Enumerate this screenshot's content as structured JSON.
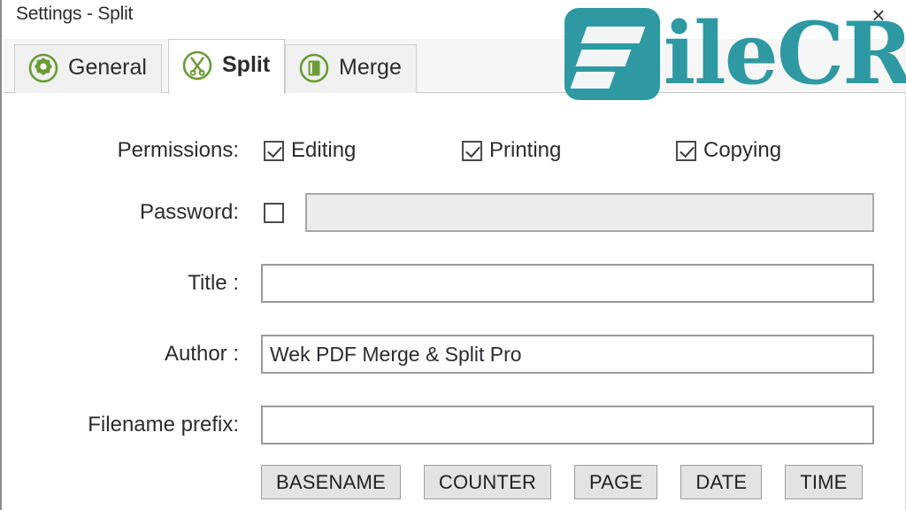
{
  "window": {
    "title": "Settings - Split",
    "close_label": "×",
    "close_icon": "close-icon"
  },
  "tabs": [
    {
      "label": "General",
      "icon": "gear-target-icon",
      "selected": false
    },
    {
      "label": "Split",
      "icon": "scissors-icon",
      "selected": true
    },
    {
      "label": "Merge",
      "icon": "document-page-icon",
      "selected": false
    }
  ],
  "form": {
    "permissions": {
      "label": "Permissions:",
      "options": [
        {
          "label": "Editing",
          "checked": true
        },
        {
          "label": "Printing",
          "checked": true
        },
        {
          "label": "Copying",
          "checked": true
        }
      ]
    },
    "password": {
      "label": "Password:",
      "checked": false,
      "value": "",
      "placeholder": "",
      "disabled": true
    },
    "title": {
      "label": "Title :",
      "value": "",
      "placeholder": ""
    },
    "author": {
      "label": "Author :",
      "value": "Wek PDF Merge & Split Pro",
      "placeholder": ""
    },
    "filename_prefix": {
      "label": "Filename prefix:",
      "value": "",
      "placeholder": ""
    },
    "tokens": [
      {
        "label": "BASENAME"
      },
      {
        "label": "COUNTER"
      },
      {
        "label": "PAGE"
      },
      {
        "label": "DATE"
      },
      {
        "label": "TIME"
      }
    ]
  },
  "watermark": {
    "text": "ileCR",
    "color": "#2e99a3"
  },
  "colors": {
    "accent_green": "#6a9b34",
    "text": "#2b2b33",
    "tab_inactive": "#f0f0f0",
    "tab_active": "#ffffff",
    "button_face": "#e3e3e3",
    "disabled_field": "#ececec"
  }
}
